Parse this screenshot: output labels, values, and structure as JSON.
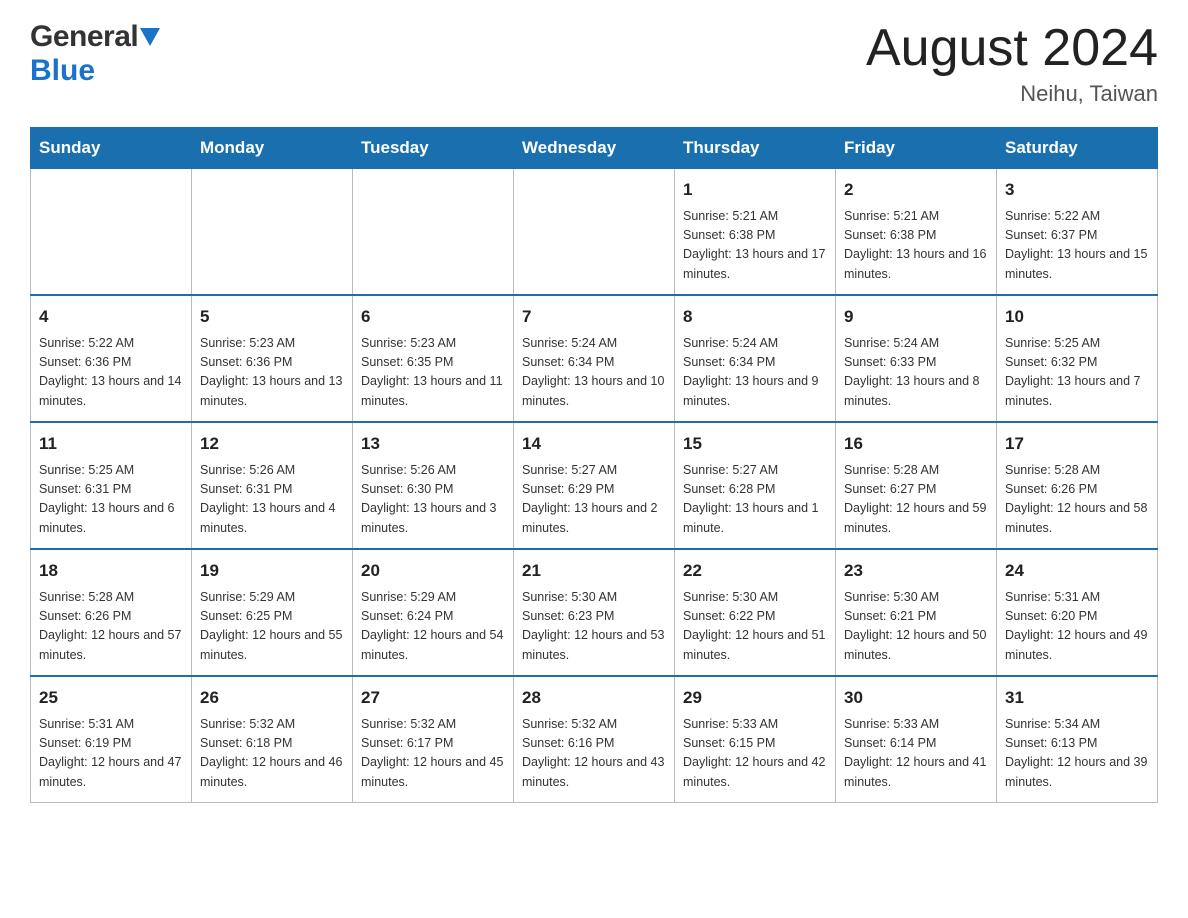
{
  "header": {
    "logo_general": "General",
    "logo_blue": "Blue",
    "month_title": "August 2024",
    "location": "Neihu, Taiwan"
  },
  "days_of_week": [
    "Sunday",
    "Monday",
    "Tuesday",
    "Wednesday",
    "Thursday",
    "Friday",
    "Saturday"
  ],
  "weeks": [
    {
      "cells": [
        {
          "day": "",
          "info": ""
        },
        {
          "day": "",
          "info": ""
        },
        {
          "day": "",
          "info": ""
        },
        {
          "day": "",
          "info": ""
        },
        {
          "day": "1",
          "info": "Sunrise: 5:21 AM\nSunset: 6:38 PM\nDaylight: 13 hours and 17 minutes."
        },
        {
          "day": "2",
          "info": "Sunrise: 5:21 AM\nSunset: 6:38 PM\nDaylight: 13 hours and 16 minutes."
        },
        {
          "day": "3",
          "info": "Sunrise: 5:22 AM\nSunset: 6:37 PM\nDaylight: 13 hours and 15 minutes."
        }
      ]
    },
    {
      "cells": [
        {
          "day": "4",
          "info": "Sunrise: 5:22 AM\nSunset: 6:36 PM\nDaylight: 13 hours and 14 minutes."
        },
        {
          "day": "5",
          "info": "Sunrise: 5:23 AM\nSunset: 6:36 PM\nDaylight: 13 hours and 13 minutes."
        },
        {
          "day": "6",
          "info": "Sunrise: 5:23 AM\nSunset: 6:35 PM\nDaylight: 13 hours and 11 minutes."
        },
        {
          "day": "7",
          "info": "Sunrise: 5:24 AM\nSunset: 6:34 PM\nDaylight: 13 hours and 10 minutes."
        },
        {
          "day": "8",
          "info": "Sunrise: 5:24 AM\nSunset: 6:34 PM\nDaylight: 13 hours and 9 minutes."
        },
        {
          "day": "9",
          "info": "Sunrise: 5:24 AM\nSunset: 6:33 PM\nDaylight: 13 hours and 8 minutes."
        },
        {
          "day": "10",
          "info": "Sunrise: 5:25 AM\nSunset: 6:32 PM\nDaylight: 13 hours and 7 minutes."
        }
      ]
    },
    {
      "cells": [
        {
          "day": "11",
          "info": "Sunrise: 5:25 AM\nSunset: 6:31 PM\nDaylight: 13 hours and 6 minutes."
        },
        {
          "day": "12",
          "info": "Sunrise: 5:26 AM\nSunset: 6:31 PM\nDaylight: 13 hours and 4 minutes."
        },
        {
          "day": "13",
          "info": "Sunrise: 5:26 AM\nSunset: 6:30 PM\nDaylight: 13 hours and 3 minutes."
        },
        {
          "day": "14",
          "info": "Sunrise: 5:27 AM\nSunset: 6:29 PM\nDaylight: 13 hours and 2 minutes."
        },
        {
          "day": "15",
          "info": "Sunrise: 5:27 AM\nSunset: 6:28 PM\nDaylight: 13 hours and 1 minute."
        },
        {
          "day": "16",
          "info": "Sunrise: 5:28 AM\nSunset: 6:27 PM\nDaylight: 12 hours and 59 minutes."
        },
        {
          "day": "17",
          "info": "Sunrise: 5:28 AM\nSunset: 6:26 PM\nDaylight: 12 hours and 58 minutes."
        }
      ]
    },
    {
      "cells": [
        {
          "day": "18",
          "info": "Sunrise: 5:28 AM\nSunset: 6:26 PM\nDaylight: 12 hours and 57 minutes."
        },
        {
          "day": "19",
          "info": "Sunrise: 5:29 AM\nSunset: 6:25 PM\nDaylight: 12 hours and 55 minutes."
        },
        {
          "day": "20",
          "info": "Sunrise: 5:29 AM\nSunset: 6:24 PM\nDaylight: 12 hours and 54 minutes."
        },
        {
          "day": "21",
          "info": "Sunrise: 5:30 AM\nSunset: 6:23 PM\nDaylight: 12 hours and 53 minutes."
        },
        {
          "day": "22",
          "info": "Sunrise: 5:30 AM\nSunset: 6:22 PM\nDaylight: 12 hours and 51 minutes."
        },
        {
          "day": "23",
          "info": "Sunrise: 5:30 AM\nSunset: 6:21 PM\nDaylight: 12 hours and 50 minutes."
        },
        {
          "day": "24",
          "info": "Sunrise: 5:31 AM\nSunset: 6:20 PM\nDaylight: 12 hours and 49 minutes."
        }
      ]
    },
    {
      "cells": [
        {
          "day": "25",
          "info": "Sunrise: 5:31 AM\nSunset: 6:19 PM\nDaylight: 12 hours and 47 minutes."
        },
        {
          "day": "26",
          "info": "Sunrise: 5:32 AM\nSunset: 6:18 PM\nDaylight: 12 hours and 46 minutes."
        },
        {
          "day": "27",
          "info": "Sunrise: 5:32 AM\nSunset: 6:17 PM\nDaylight: 12 hours and 45 minutes."
        },
        {
          "day": "28",
          "info": "Sunrise: 5:32 AM\nSunset: 6:16 PM\nDaylight: 12 hours and 43 minutes."
        },
        {
          "day": "29",
          "info": "Sunrise: 5:33 AM\nSunset: 6:15 PM\nDaylight: 12 hours and 42 minutes."
        },
        {
          "day": "30",
          "info": "Sunrise: 5:33 AM\nSunset: 6:14 PM\nDaylight: 12 hours and 41 minutes."
        },
        {
          "day": "31",
          "info": "Sunrise: 5:34 AM\nSunset: 6:13 PM\nDaylight: 12 hours and 39 minutes."
        }
      ]
    }
  ]
}
